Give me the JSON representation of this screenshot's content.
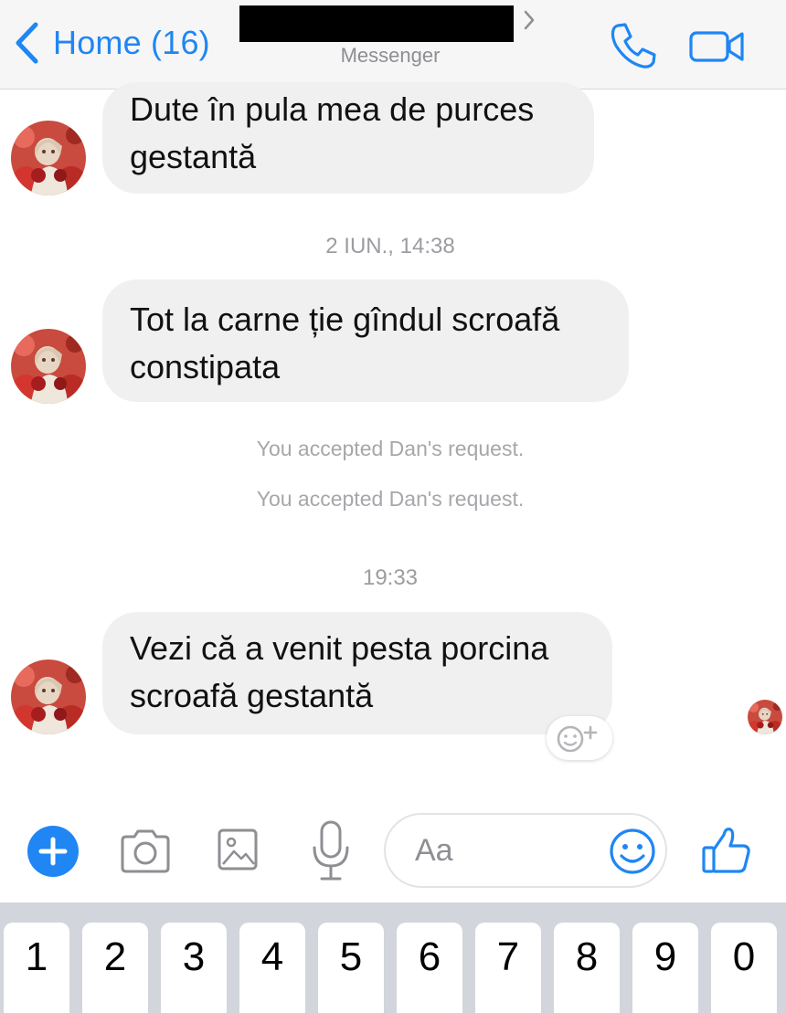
{
  "header": {
    "back_label": "Home (16)",
    "subtitle": "Messenger",
    "icons": {
      "back": "chevron-left-icon",
      "title": "chevron-right-icon",
      "call": "phone-icon",
      "video": "video-camera-icon"
    }
  },
  "messages": [
    {
      "sender": "contact",
      "lines": [
        "Dute în pula mea de purces",
        "gestantă"
      ]
    },
    {
      "timestamp": "2 IUN., 14:38"
    },
    {
      "sender": "contact",
      "lines": [
        "Tot la carne ție gîndul scroafă",
        "constipata"
      ]
    },
    {
      "system": "You accepted Dan's request."
    },
    {
      "system": "You accepted Dan's request."
    },
    {
      "timestamp": "19:33"
    },
    {
      "sender": "contact",
      "lines": [
        "Vezi că a venit pesta porcina",
        "scroafă gestantă"
      ]
    }
  ],
  "composer": {
    "placeholder": "Aa",
    "icons": [
      "plus-icon",
      "camera-icon",
      "image-icon",
      "microphone-icon",
      "emoji-icon",
      "thumbs-up-icon"
    ]
  },
  "keyboard": {
    "keys": [
      "1",
      "2",
      "3",
      "4",
      "5",
      "6",
      "7",
      "8",
      "9",
      "0"
    ]
  },
  "colors": {
    "accent": "#1f86f4",
    "bubble": "#f1f0f0",
    "header_bg": "#f6f6f7",
    "keyboard_bg": "#d2d5db"
  }
}
